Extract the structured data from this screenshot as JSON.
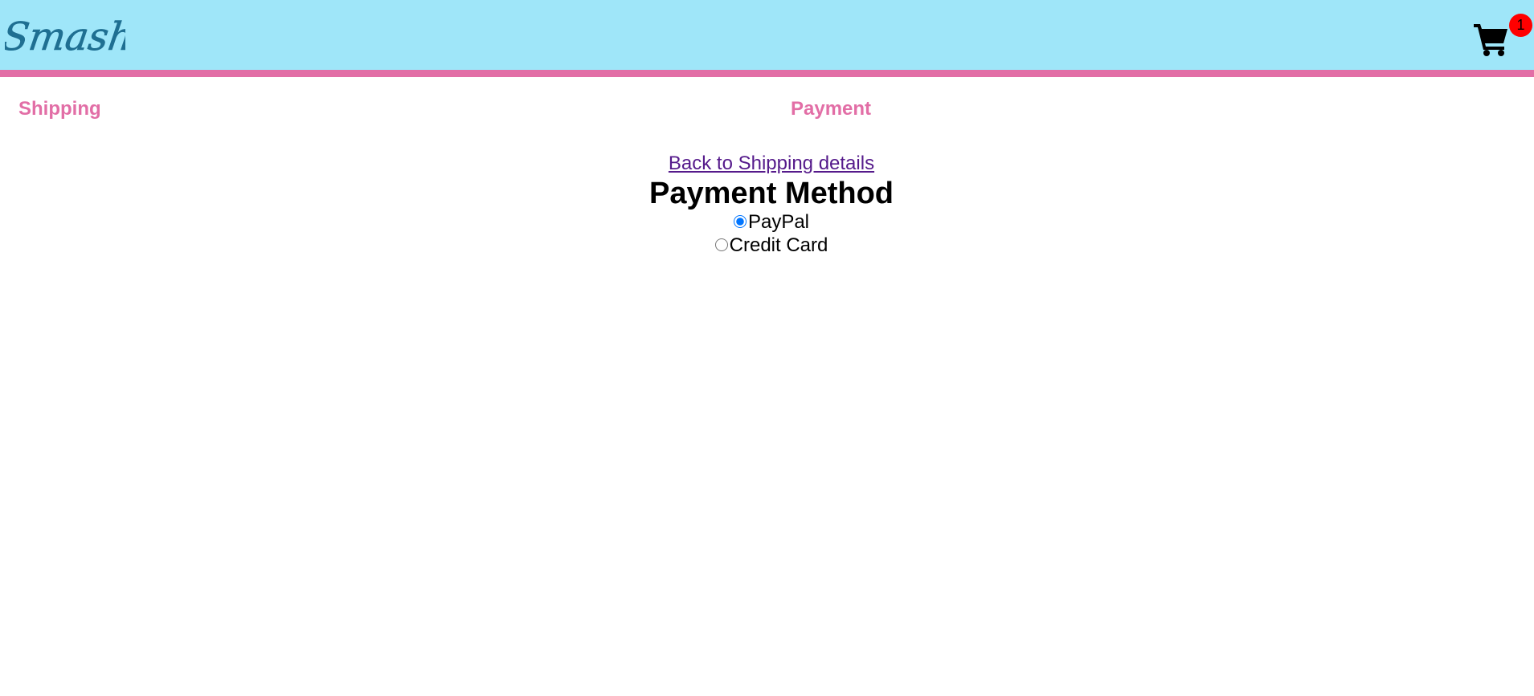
{
  "header": {
    "logo_text": "Smash",
    "background_color": "#9fe6f9",
    "accent_color": "#e26ea6",
    "cart": {
      "icon": "shopping-cart-icon",
      "badge_count": "1",
      "badge_color": "#ff0000"
    }
  },
  "steps": {
    "shipping_label": "Shipping",
    "payment_label": "Payment"
  },
  "payment": {
    "back_link": "Back to Shipping details",
    "title": "Payment Method",
    "options": [
      {
        "label": "PayPal",
        "selected": true
      },
      {
        "label": "Credit Card",
        "selected": false
      }
    ]
  }
}
